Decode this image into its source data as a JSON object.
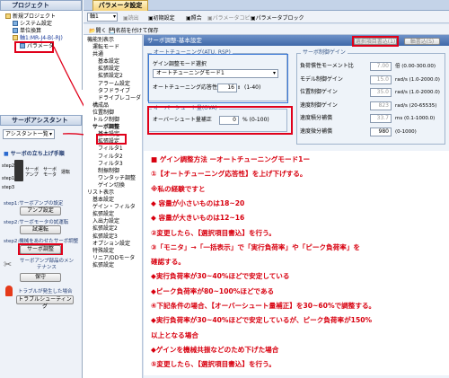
{
  "project_panel": {
    "title": "プロジェクト",
    "items": [
      "新規プロジェクト",
      "システム設定",
      "単位換算",
      "軸1:MR-J4-B(-RJ)",
      "パラメータ"
    ]
  },
  "assistant_panel": {
    "title": "サーボアシスタント",
    "dropdown": "アシスタント一覧",
    "section1": "サーボの立ち上げ手順",
    "step_labels": [
      "step1",
      "step2",
      "step3"
    ],
    "step_texts": [
      "サーボアンプ",
      "サーボモータ",
      "運転"
    ],
    "step1_text": "step1:サーボアンプの設定",
    "step1_btn": "アンプ設定",
    "step2a_text": "step2:サーボモータの試運転",
    "step2a_btn": "試運転",
    "step2b_text": "step2:機械をあわせたサーボ調整",
    "step2b_btn": "サーボ調整",
    "maint_text": "サーボアンプ部品のメンテナンス",
    "maint_btn": "保守",
    "trouble_text": "トラブルが発生した場合",
    "trouble_btn": "トラブルシューティング"
  },
  "param_window": {
    "tab": "パラメータ設定",
    "axis": "軸1",
    "toolbar": [
      "読出",
      "初期設定",
      "照合",
      "パラメータコピー",
      "パラメータブロック"
    ],
    "toolbar2": [
      "開く",
      "名前を付けて保存"
    ],
    "tree_items": [
      "機能別表示",
      "運転モード",
      "共通",
      "基本設定",
      "拡張設定",
      "拡張設定2",
      "アラーム設定",
      "タフドライブ",
      "ドライブレコーダ",
      "構成品",
      "位置制御",
      "トルク制御",
      "サーボ調整",
      "基本設定",
      "拡張設定",
      "フィルタ1",
      "フィルタ2",
      "フィルタ3",
      "制振制御",
      "ワンタッチ調整",
      "ゲイン切換",
      "リスト表示",
      "基本設定",
      "ゲイン・フィルタ",
      "拡張設定",
      "入出力設定",
      "拡張設定2",
      "拡張設定3",
      "オプション設定",
      "特殊設定",
      "リニア/DDモータ",
      "拡張設定"
    ],
    "header": "サーボ調整-基本設定",
    "btn_write": "選択項目書込(1)",
    "btn_axis": "軸書込(S)",
    "auto_tuning_group": "オートチューニング(ATU, RSP)",
    "gain_mode_label": "ゲイン調整モード選択",
    "gain_mode_value": "オートチューニングモード1",
    "response_label": "オートチューニング応答性",
    "response_value": "16",
    "response_range": "(1-40)",
    "overshoot_group": "オーバーシュート量(OVA)",
    "overshoot_label": "オーバーシュート量補正",
    "overshoot_value": "0",
    "overshoot_unit": "% (0-100)",
    "servo_gain_group": "サーボ制御ゲイン",
    "gain_rows": [
      {
        "label": "負荷慣性モーメント比",
        "value": "7.00",
        "unit": "倍 (0.00-300.00)"
      },
      {
        "label": "モデル制御ゲイン",
        "value": "15.0",
        "unit": "rad/s (1.0-2000.0)"
      },
      {
        "label": "位置制御ゲイン",
        "value": "35.0",
        "unit": "rad/s (1.0-2000.0)"
      },
      {
        "label": "速度制御ゲイン",
        "value": "823",
        "unit": "rad/s (20-65535)"
      },
      {
        "label": "速度積分補償",
        "value": "33.7",
        "unit": "ms (0.1-1000.0)"
      },
      {
        "label": "速度微分補償",
        "value": "980",
        "unit": "(0-1000)"
      }
    ]
  },
  "annotation": {
    "lines": [
      "■ ゲイン調整方法 ーオートチューニングモード1ー",
      "①【オートチューニング応答性】を上げ下げする。",
      "  ※私の経験ですと",
      "   ◆ 容量が小さいものは18~20",
      "   ◆ 容量が大きいものは12~16",
      "②変更したら、【選択項目書込】を行う。",
      "③「モニタ」→「一括表示」で「実行負荷率」や「ピーク負荷率」を",
      "  確認する。",
      "  ◆実行負荷率が30~40%ほどで安定している",
      "  ◆ピーク負荷率が80~100%ほどである",
      "④下記条件の場合、【オーバーシュート量補正】を30~60%で調整する。",
      "  ◆実行負荷率が30~40%ほどで安定しているが、ピーク負荷率が150%",
      "   以上となる場合",
      "  ◆ゲインを機械共振などのため下げた場合",
      "⑤変更したら、【選択項目書込】を行う。"
    ]
  }
}
